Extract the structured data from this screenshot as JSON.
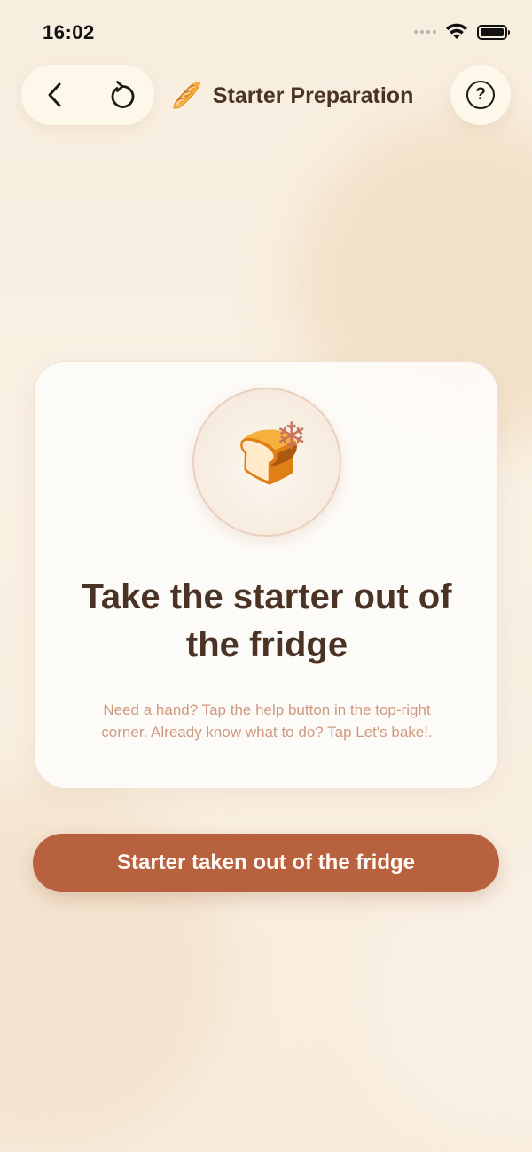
{
  "status_bar": {
    "time": "16:02"
  },
  "header": {
    "title": "Starter Preparation",
    "title_icon": "bread-icon",
    "back_icon": "chevron-left-icon",
    "restart_icon": "restart-icon",
    "help_icon": "help-icon",
    "help_glyph": "?"
  },
  "card": {
    "icon": "bread-snowflake-icon",
    "title": "Take the starter out of the fridge",
    "description": "Need a hand? Tap the help button in the top-right corner. Already know what to do? Tap Let's bake!."
  },
  "actions": {
    "primary_label": "Starter taken out of the fridge"
  },
  "colors": {
    "accent": "#b8613f",
    "title_text": "#4a3324",
    "description_text": "#cf9a80",
    "background": "#f8efe1"
  }
}
